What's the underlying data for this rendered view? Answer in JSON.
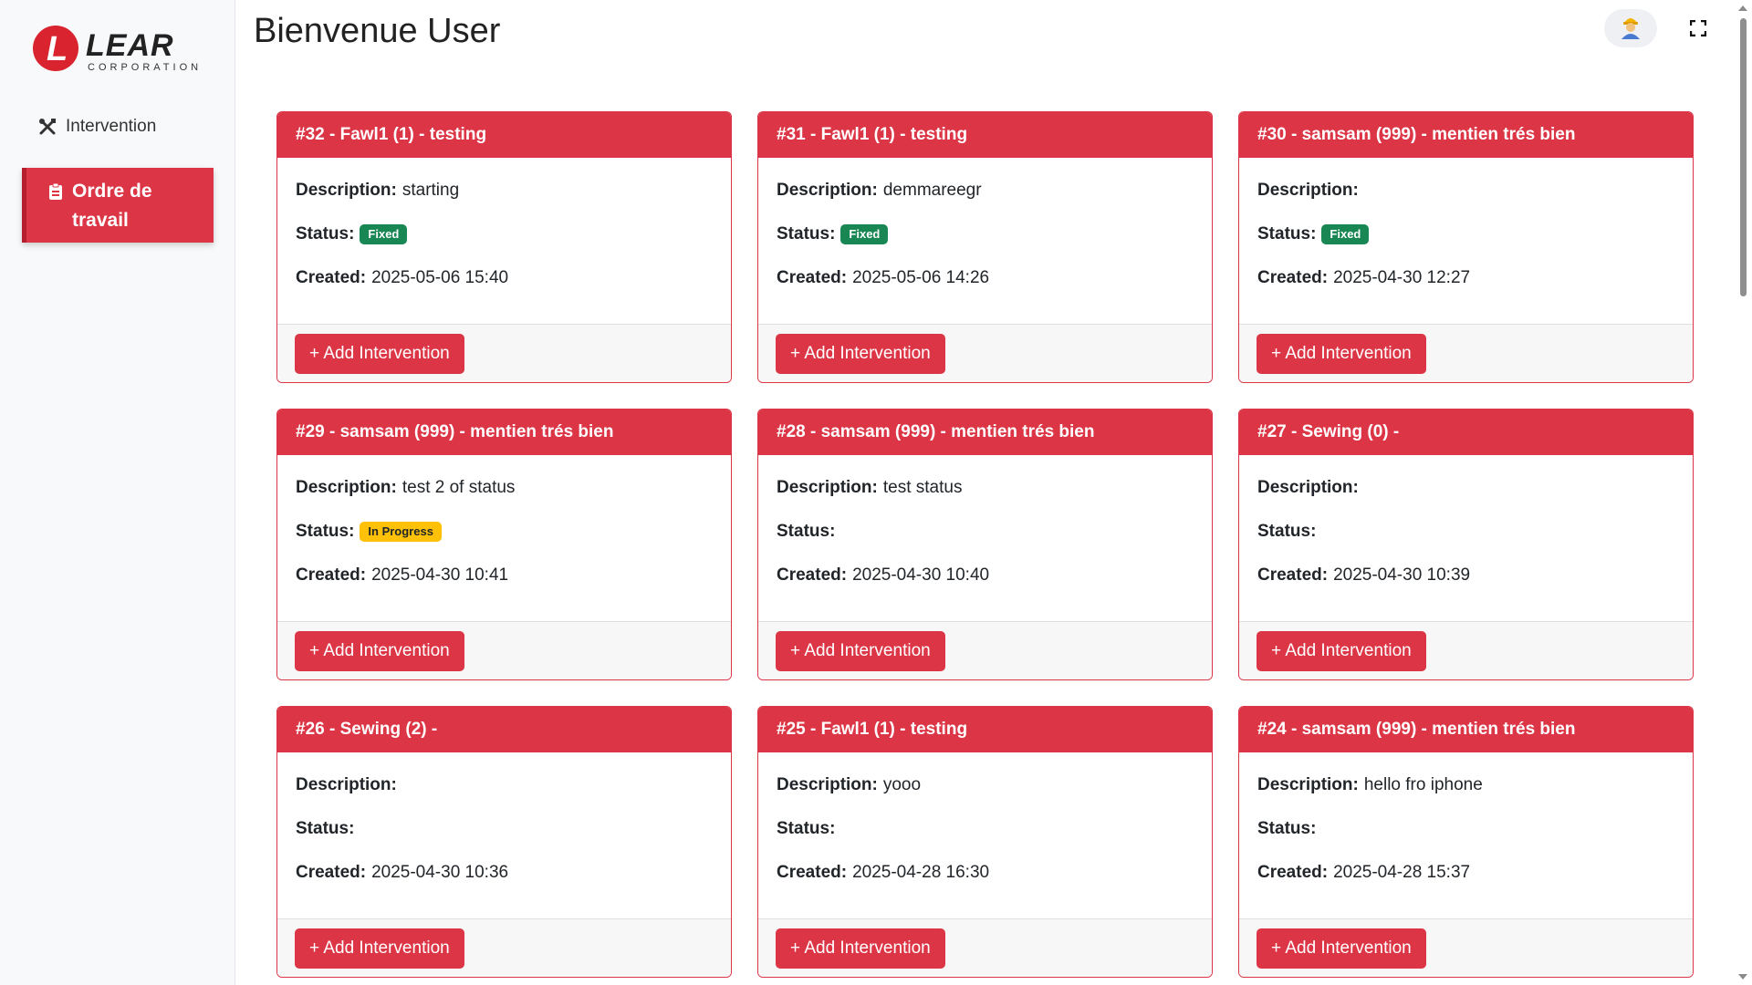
{
  "brand": {
    "logo_letter": "L",
    "logo_word": "LEAR",
    "logo_sub": "CORPORATION",
    "accent": "#dc3545"
  },
  "sidebar": {
    "items": [
      {
        "label": "Intervention",
        "icon": "tools-icon",
        "active": false
      },
      {
        "label": "Ordre de travail",
        "icon": "clipboard-icon",
        "active": true
      }
    ]
  },
  "header": {
    "title": "Bienvenue User",
    "avatar_icon": "worker-avatar-icon",
    "fullscreen_icon": "fullscreen-icon"
  },
  "labels": {
    "description": "Description:",
    "status": "Status:",
    "created": "Created:",
    "add_button": "+ Add Intervention"
  },
  "status_colors": {
    "Fixed": "#198754",
    "In Progress": "#ffc107"
  },
  "cards": [
    {
      "title": "#32 - Fawl1 (1) - testing",
      "description": "starting",
      "status": "Fixed",
      "created": "2025-05-06 15:40"
    },
    {
      "title": "#31 - Fawl1 (1) - testing",
      "description": "demmareegr",
      "status": "Fixed",
      "created": "2025-05-06 14:26"
    },
    {
      "title": "#30 - samsam (999) - mentien trés bien",
      "description": "",
      "status": "Fixed",
      "created": "2025-04-30 12:27"
    },
    {
      "title": "#29 - samsam (999) - mentien trés bien",
      "description": "test 2 of status",
      "status": "In Progress",
      "created": "2025-04-30 10:41"
    },
    {
      "title": "#28 - samsam (999) - mentien trés bien",
      "description": "test status",
      "status": "",
      "created": "2025-04-30 10:40"
    },
    {
      "title": "#27 - Sewing (0) -",
      "description": "",
      "status": "",
      "created": "2025-04-30 10:39"
    },
    {
      "title": "#26 - Sewing (2) -",
      "description": "",
      "status": "",
      "created": "2025-04-30 10:36"
    },
    {
      "title": "#25 - Fawl1 (1) - testing",
      "description": "yooo",
      "status": "",
      "created": "2025-04-28 16:30"
    },
    {
      "title": "#24 - samsam (999) - mentien trés bien",
      "description": "hello fro iphone",
      "status": "",
      "created": "2025-04-28 15:37"
    }
  ]
}
